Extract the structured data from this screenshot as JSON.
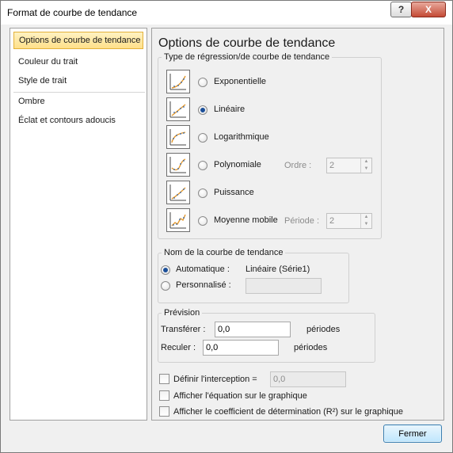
{
  "window": {
    "title": "Format de courbe de tendance",
    "help_label": "?",
    "close_label": "X"
  },
  "nav": {
    "items": [
      {
        "label": "Options de courbe de tendance"
      },
      {
        "label": "Couleur du trait"
      },
      {
        "label": "Style de trait"
      },
      {
        "label": "Ombre"
      },
      {
        "label": "Éclat et contours adoucis"
      }
    ],
    "selected": "Options de courbe de tendance"
  },
  "panel": {
    "title": "Options de courbe de tendance",
    "regression": {
      "legend": "Type de régression/de courbe de tendance",
      "options": [
        {
          "label": "Exponentielle",
          "icon": "exponential-chart-icon",
          "checked": false
        },
        {
          "label": "Linéaire",
          "icon": "linear-chart-icon",
          "checked": true
        },
        {
          "label": "Logarithmique",
          "icon": "logarithmic-chart-icon",
          "checked": false
        },
        {
          "label": "Polynomiale",
          "icon": "polynomial-chart-icon",
          "checked": false
        },
        {
          "label": "Puissance",
          "icon": "power-chart-icon",
          "checked": false
        },
        {
          "label": "Moyenne mobile",
          "icon": "moving-average-chart-icon",
          "checked": false
        }
      ],
      "order_label": "Ordre :",
      "order_value": "2",
      "period_label": "Période :",
      "period_value": "2"
    },
    "name": {
      "legend": "Nom de la courbe de tendance",
      "auto_label": "Automatique :",
      "auto_value": "Linéaire (Série1)",
      "custom_label": "Personnalisé :",
      "custom_value": "",
      "auto_checked": true
    },
    "forecast": {
      "legend": "Prévision",
      "forward_label": "Transférer :",
      "forward_value": "0,0",
      "forward_unit": "périodes",
      "backward_label": "Reculer :",
      "backward_value": "0,0",
      "backward_unit": "périodes"
    },
    "intercept": {
      "label": "Définir l'interception =",
      "value": "0,0",
      "checked": false
    },
    "show_equation": {
      "label": "Afficher l'équation sur le graphique",
      "checked": false
    },
    "show_r2": {
      "label": "Afficher le coefficient de détermination (R²) sur le graphique",
      "checked": false
    }
  },
  "footer": {
    "close_button": "Fermer"
  },
  "colors": {
    "selection_bg": "#ffe08a",
    "radio_dot": "#1b4f99",
    "button_border": "#3c7fb1"
  }
}
